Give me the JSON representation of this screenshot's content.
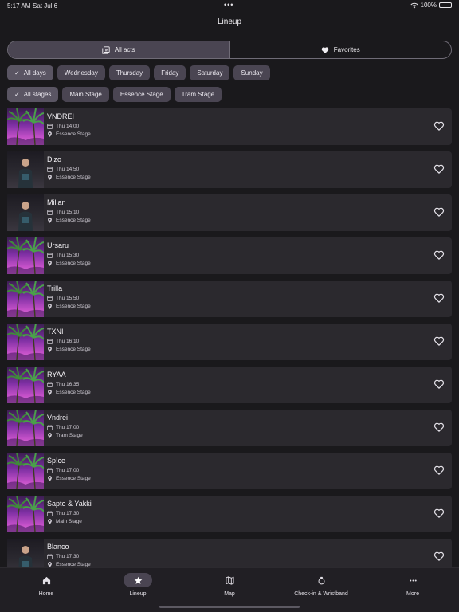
{
  "status_bar": {
    "time": "5:17 AM",
    "date": "Sat Jul 6",
    "battery": "100%",
    "dots": "•••"
  },
  "nav": {
    "title": "Lineup"
  },
  "segments": [
    {
      "label": "All acts",
      "icon": "library-icon",
      "active": true
    },
    {
      "label": "Favorites",
      "icon": "heart-icon",
      "active": false
    }
  ],
  "day_filters": [
    {
      "label": "All days",
      "selected": true
    },
    {
      "label": "Wednesday",
      "selected": false
    },
    {
      "label": "Thursday",
      "selected": false
    },
    {
      "label": "Friday",
      "selected": false
    },
    {
      "label": "Saturday",
      "selected": false
    },
    {
      "label": "Sunday",
      "selected": false
    }
  ],
  "stage_filters": [
    {
      "label": "All stages",
      "selected": true
    },
    {
      "label": "Main Stage",
      "selected": false
    },
    {
      "label": "Essence Stage",
      "selected": false
    },
    {
      "label": "Tram Stage",
      "selected": false
    }
  ],
  "acts": [
    {
      "name": "VNDREI",
      "time": "Thu 14:00",
      "stage": "Essence Stage",
      "image": "palm"
    },
    {
      "name": "Dizo",
      "time": "Thu 14:50",
      "stage": "Essence Stage",
      "image": "photo"
    },
    {
      "name": "Milian",
      "time": "Thu 15:10",
      "stage": "Essence Stage",
      "image": "photo"
    },
    {
      "name": "Ursaru",
      "time": "Thu 15:30",
      "stage": "Essence Stage",
      "image": "palm"
    },
    {
      "name": "Trilla",
      "time": "Thu 15:50",
      "stage": "Essence Stage",
      "image": "palm"
    },
    {
      "name": "TXNI",
      "time": "Thu 16:10",
      "stage": "Essence Stage",
      "image": "palm"
    },
    {
      "name": "RYAA",
      "time": "Thu 16:35",
      "stage": "Essence Stage",
      "image": "palm"
    },
    {
      "name": "Vndrei",
      "time": "Thu 17:00",
      "stage": "Tram Stage",
      "image": "palm"
    },
    {
      "name": "Sp!ce",
      "time": "Thu 17:00",
      "stage": "Essence Stage",
      "image": "palm"
    },
    {
      "name": "Sapte & Yakki",
      "time": "Thu 17:30",
      "stage": "Main Stage",
      "image": "palm"
    },
    {
      "name": "Blanco",
      "time": "Thu 17:30",
      "stage": "Essence Stage",
      "image": "photo"
    }
  ],
  "tabs": [
    {
      "label": "Home",
      "icon": "home-icon",
      "active": false
    },
    {
      "label": "Lineup",
      "icon": "star-icon",
      "active": true
    },
    {
      "label": "Map",
      "icon": "map-icon",
      "active": false
    },
    {
      "label": "Check-in & Wristband",
      "icon": "wristband-icon",
      "active": false
    },
    {
      "label": "More",
      "icon": "more-icon",
      "active": false
    }
  ],
  "colors": {
    "background": "#1a191c",
    "card": "#2b292e",
    "chip": "#4a4552",
    "accent_gradient_top": "#3a1e4f",
    "accent_gradient_bottom": "#e078d6"
  }
}
